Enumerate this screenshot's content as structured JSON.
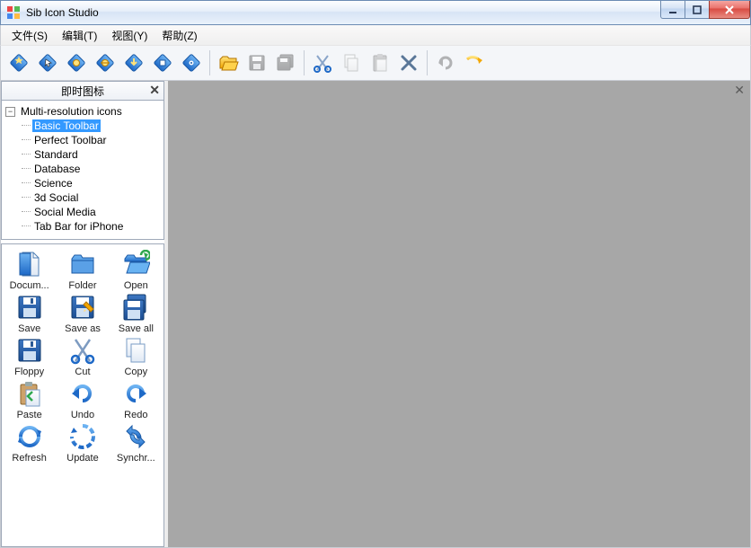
{
  "window": {
    "title": "Sib Icon Studio"
  },
  "menu": {
    "file": "文件(S)",
    "edit": "编辑(T)",
    "view": "视图(Y)",
    "help": "帮助(Z)"
  },
  "toolbar": [
    {
      "name": "new-icon",
      "enabled": true
    },
    {
      "name": "new-cursor",
      "enabled": true
    },
    {
      "name": "open-library",
      "enabled": true
    },
    {
      "name": "open-web",
      "enabled": true
    },
    {
      "name": "export",
      "enabled": true
    },
    {
      "name": "library",
      "enabled": true
    },
    {
      "name": "preview",
      "enabled": true
    },
    {
      "sep": true
    },
    {
      "name": "open-file",
      "enabled": true
    },
    {
      "name": "save",
      "enabled": false
    },
    {
      "name": "save-all",
      "enabled": false
    },
    {
      "sep": true
    },
    {
      "name": "cut",
      "enabled": true
    },
    {
      "name": "copy",
      "enabled": false
    },
    {
      "name": "paste",
      "enabled": false
    },
    {
      "name": "delete",
      "enabled": true
    },
    {
      "sep": true
    },
    {
      "name": "undo",
      "enabled": false
    },
    {
      "name": "redo",
      "enabled": true
    }
  ],
  "panel": {
    "title": "即时图标"
  },
  "tree": {
    "root": "Multi-resolution icons",
    "children": [
      "Basic Toolbar",
      "Perfect Toolbar",
      "Standard",
      "Database",
      "Science",
      "3d Social",
      "Social Media",
      "Tab Bar for iPhone"
    ],
    "selectedIndex": 0
  },
  "icons": [
    {
      "label": "Docum...",
      "kind": "document"
    },
    {
      "label": "Folder",
      "kind": "folder"
    },
    {
      "label": "Open",
      "kind": "open"
    },
    {
      "label": "Save",
      "kind": "floppy"
    },
    {
      "label": "Save as",
      "kind": "floppy-pencil"
    },
    {
      "label": "Save all",
      "kind": "floppy-multi"
    },
    {
      "label": "Floppy",
      "kind": "floppy"
    },
    {
      "label": "Cut",
      "kind": "cut"
    },
    {
      "label": "Copy",
      "kind": "copy"
    },
    {
      "label": "Paste",
      "kind": "paste"
    },
    {
      "label": "Undo",
      "kind": "undo"
    },
    {
      "label": "Redo",
      "kind": "redo"
    },
    {
      "label": "Refresh",
      "kind": "refresh"
    },
    {
      "label": "Update",
      "kind": "update"
    },
    {
      "label": "Synchr...",
      "kind": "sync"
    }
  ]
}
